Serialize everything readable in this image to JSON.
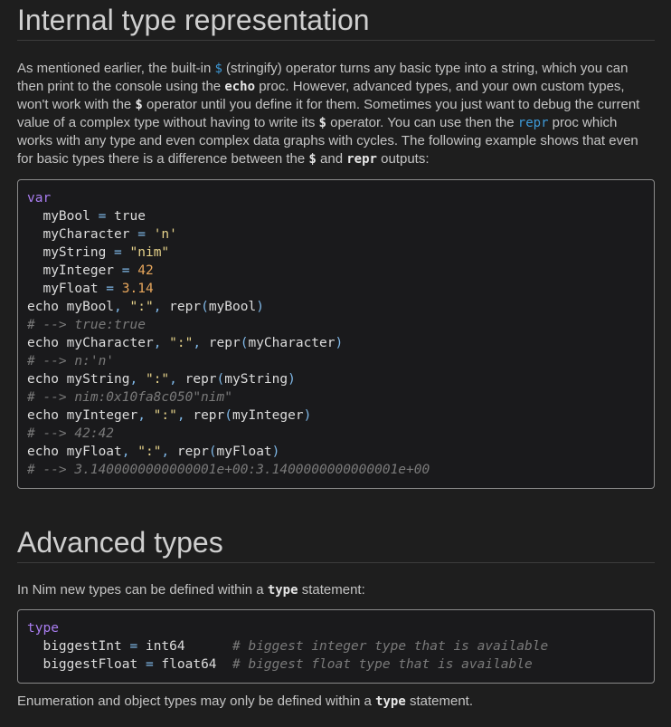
{
  "section1": {
    "title": "Internal type representation",
    "paragraph": {
      "t1": "As mentioned earlier, the built-in ",
      "c_dollar1": "$",
      "t2": " (stringify) operator turns any basic type into a string, which you can then print to the console using the ",
      "c_echo": "echo",
      "t3": " proc. However, advanced types, and your own custom types, won't work with the ",
      "c_dollar2": "$",
      "t4": " operator until you define it for them. Sometimes you just want to debug the current value of a complex type without having to write its ",
      "c_dollar3": "$",
      "t5": " operator. You can use then the ",
      "c_repr_link": "repr",
      "t6": " proc which works with any type and even complex data graphs with cycles. The following example shows that even for basic types there is a difference between the ",
      "c_dollar4": "$",
      "t7": " and ",
      "c_repr": "repr",
      "t8": " outputs:"
    },
    "code": {
      "l1_var": "var",
      "l2_name": "  myBool",
      "l2_eq": " = ",
      "l2_val": "true",
      "l3_name": "  myCharacter",
      "l3_eq": " = ",
      "l3_val": "'n'",
      "l4_name": "  myString",
      "l4_eq": " = ",
      "l4_val": "\"nim\"",
      "l5_name": "  myInteger",
      "l5_eq": " = ",
      "l5_val": "42",
      "l6_name": "  myFloat",
      "l6_eq": " = ",
      "l6_val": "3.14",
      "l7_a": "echo myBool",
      "l7_comma1": ",",
      "l7_str": " \":\"",
      "l7_comma2": ",",
      "l7_b": " repr",
      "l7_lp": "(",
      "l7_arg": "myBool",
      "l7_rp": ")",
      "l8_cmt": "# --> true:true",
      "l9_a": "echo myCharacter",
      "l9_comma1": ",",
      "l9_str": " \":\"",
      "l9_comma2": ",",
      "l9_b": " repr",
      "l9_lp": "(",
      "l9_arg": "myCharacter",
      "l9_rp": ")",
      "l10_cmt": "# --> n:'n'",
      "l11_a": "echo myString",
      "l11_comma1": ",",
      "l11_str": " \":\"",
      "l11_comma2": ",",
      "l11_b": " repr",
      "l11_lp": "(",
      "l11_arg": "myString",
      "l11_rp": ")",
      "l12_cmt": "# --> nim:0x10fa8c050\"nim\"",
      "l13_a": "echo myInteger",
      "l13_comma1": ",",
      "l13_str": " \":\"",
      "l13_comma2": ",",
      "l13_b": " repr",
      "l13_lp": "(",
      "l13_arg": "myInteger",
      "l13_rp": ")",
      "l14_cmt": "# --> 42:42",
      "l15_a": "echo myFloat",
      "l15_comma1": ",",
      "l15_str": " \":\"",
      "l15_comma2": ",",
      "l15_b": " repr",
      "l15_lp": "(",
      "l15_arg": "myFloat",
      "l15_rp": ")",
      "l16_cmt": "# --> 3.1400000000000001e+00:3.1400000000000001e+00"
    }
  },
  "section2": {
    "title": "Advanced types",
    "intro": {
      "t1": "In Nim new types can be defined within a ",
      "c_type": "type",
      "t2": " statement:"
    },
    "code": {
      "l1_type": "type",
      "l2_name": "  biggestInt",
      "l2_eq": " = ",
      "l2_val": "int64",
      "l2_pad": "      ",
      "l2_cmt": "# biggest integer type that is available",
      "l3_name": "  biggestFloat",
      "l3_eq": " = ",
      "l3_val": "float64",
      "l3_pad": "  ",
      "l3_cmt": "# biggest float type that is available"
    },
    "outro": {
      "t1": "Enumeration and object types may only be defined within a ",
      "c_type": "type",
      "t2": " statement."
    }
  }
}
